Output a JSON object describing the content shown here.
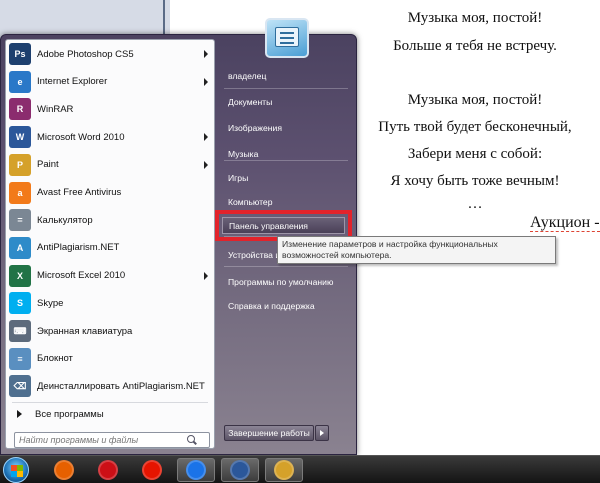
{
  "document": {
    "lines": [
      "Музыка моя, постой!",
      "Больше я тебя не встречу.",
      "Музыка моя, постой!",
      "Путь твой будет бесконечный,",
      "Забери меня с собой:",
      "Я хочу быть тоже вечным!",
      "…",
      "Аукцион -"
    ]
  },
  "start_menu": {
    "programs": [
      {
        "label": "Adobe Photoshop CS5",
        "icon": "photoshop-icon",
        "icon_text": "Ps",
        "color": "#1d3f6e",
        "has_submenu": true
      },
      {
        "label": "Internet Explorer",
        "icon": "internet-explorer-icon",
        "icon_text": "e",
        "color": "#2a78c8",
        "has_submenu": true
      },
      {
        "label": "WinRAR",
        "icon": "winrar-icon",
        "icon_text": "R",
        "color": "#8b2c6e",
        "has_submenu": false
      },
      {
        "label": "Microsoft Word 2010",
        "icon": "word-icon",
        "icon_text": "W",
        "color": "#2b579a",
        "has_submenu": true
      },
      {
        "label": "Paint",
        "icon": "paint-icon",
        "icon_text": "P",
        "color": "#d5a12a",
        "has_submenu": true
      },
      {
        "label": "Avast Free Antivirus",
        "icon": "avast-icon",
        "icon_text": "a",
        "color": "#f27a1a",
        "has_submenu": false
      },
      {
        "label": "Калькулятор",
        "icon": "calculator-icon",
        "icon_text": "=",
        "color": "#7b8794",
        "has_submenu": false
      },
      {
        "label": "AntiPlagiarism.NET",
        "icon": "antiplagiarism-icon",
        "icon_text": "A",
        "color": "#2e8bc9",
        "has_submenu": false
      },
      {
        "label": "Microsoft Excel 2010",
        "icon": "excel-icon",
        "icon_text": "X",
        "color": "#217346",
        "has_submenu": true
      },
      {
        "label": "Skype",
        "icon": "skype-icon",
        "icon_text": "S",
        "color": "#00aff0",
        "has_submenu": false
      },
      {
        "label": "Экранная клавиатура",
        "icon": "on-screen-keyboard-icon",
        "icon_text": "⌨",
        "color": "#5d6b7c",
        "has_submenu": false
      },
      {
        "label": "Блокнот",
        "icon": "notepad-icon",
        "icon_text": "≡",
        "color": "#5a8fc0",
        "has_submenu": false
      },
      {
        "label": "Деинсталлировать AntiPlagiarism.NET",
        "icon": "uninstall-icon",
        "icon_text": "⌫",
        "color": "#4f6f8f",
        "has_submenu": false
      }
    ],
    "all_programs": "Все программы",
    "search_placeholder": "Найти программы и файлы",
    "right_items": [
      {
        "label": "владелец",
        "has_submenu": false
      },
      {
        "label": "Документы",
        "has_submenu": false
      },
      {
        "label": "Изображения",
        "has_submenu": false
      },
      {
        "label": "Музыка",
        "has_submenu": false
      },
      {
        "label": "Игры",
        "has_submenu": false
      },
      {
        "label": "Компьютер",
        "has_submenu": false
      },
      {
        "label": "Панель управления",
        "has_submenu": false
      },
      {
        "label": "Устройства и принтеры",
        "has_submenu": false
      },
      {
        "label": "Программы по умолчанию",
        "has_submenu": false
      },
      {
        "label": "Справка и поддержка",
        "has_submenu": false
      }
    ],
    "tooltip": "Изменение параметров и настройка функциональных возможностей компьютера.",
    "shutdown": "Завершение работы"
  },
  "taskbar": {
    "apps": [
      {
        "name": "firefox-icon",
        "color": "#e66000"
      },
      {
        "name": "opera-icon",
        "color": "#cc0f16"
      },
      {
        "name": "yandex-browser-icon",
        "color": "#e61400"
      },
      {
        "name": "chrome-icon",
        "color": "#1a73e8"
      },
      {
        "name": "word-icon",
        "color": "#2b579a"
      },
      {
        "name": "paint-icon",
        "color": "#d5a12a"
      }
    ]
  }
}
